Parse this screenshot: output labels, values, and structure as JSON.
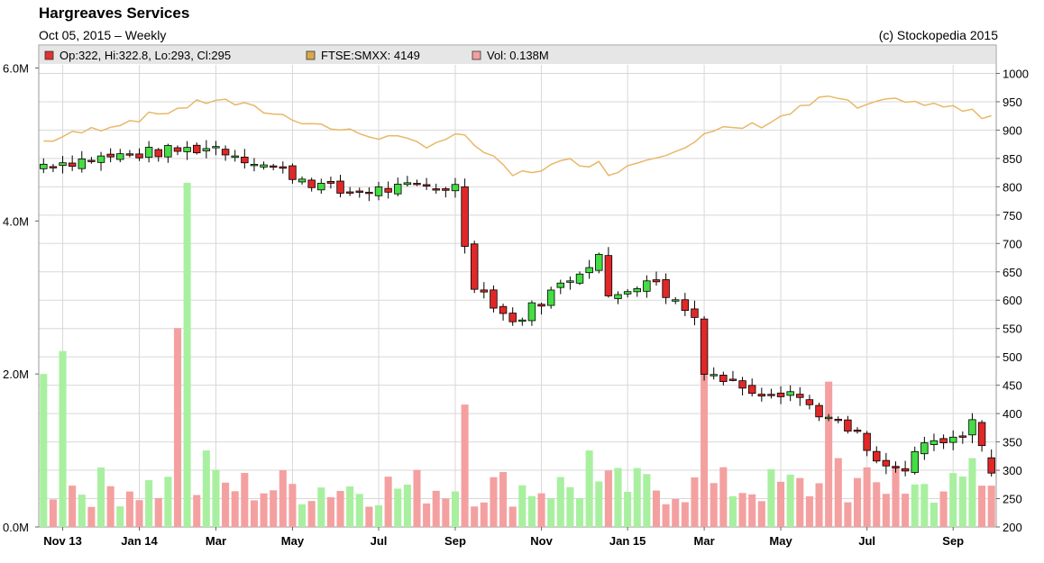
{
  "header": {
    "title": "Hargreaves Services",
    "subtitle": "Oct 05, 2015 – Weekly",
    "copyright": "(c) Stockopedia 2015"
  },
  "legend": [
    {
      "label": "Op:322, Hi:322.8, Lo:293, Cl:295",
      "color": "#e03030"
    },
    {
      "label": "FTSE:SMXX: 4149",
      "color": "#d9a84a"
    },
    {
      "label": "Vol: 0.138M",
      "color": "#f4a0a0"
    }
  ],
  "colors": {
    "up": "#44dd44",
    "down": "#e02828",
    "index": "#e8b868",
    "vol_up": "#a8f0a0",
    "vol_down": "#f4a0a0",
    "grid": "#d8d8d8"
  },
  "chart_data": {
    "type": "candlestick",
    "title": "Hargreaves Services",
    "price_axis": {
      "ticks": [
        200,
        250,
        300,
        350,
        400,
        450,
        500,
        550,
        600,
        650,
        700,
        750,
        800,
        850,
        900,
        950,
        1000
      ],
      "range": [
        200,
        1050
      ],
      "side": "right"
    },
    "volume_axis": {
      "ticks": [
        "0.0M",
        "2.0M",
        "4.0M",
        "6.0M"
      ],
      "tick_values": [
        0,
        2,
        4,
        6
      ],
      "range": [
        0,
        6.3
      ],
      "side": "left"
    },
    "x_ticks": [
      {
        "label": "Nov 13",
        "week": 2
      },
      {
        "label": "Jan 14",
        "week": 10
      },
      {
        "label": "Mar",
        "week": 18
      },
      {
        "label": "May",
        "week": 26
      },
      {
        "label": "Jul",
        "week": 35
      },
      {
        "label": "Sep",
        "week": 43
      },
      {
        "label": "Nov",
        "week": 52
      },
      {
        "label": "Jan 15",
        "week": 61
      },
      {
        "label": "Mar",
        "week": 69
      },
      {
        "label": "May",
        "week": 77
      },
      {
        "label": "Jul",
        "week": 86
      },
      {
        "label": "Sep",
        "week": 95
      }
    ],
    "num_weeks": 100,
    "key_points": [
      {
        "week": 0,
        "close": 840,
        "index": 880
      },
      {
        "week": 11,
        "close": 860,
        "index": 925
      },
      {
        "week": 18,
        "close": 870,
        "index": 955
      },
      {
        "week": 31,
        "close": 790,
        "index": 900
      },
      {
        "week": 40,
        "close": 800,
        "index": 875
      },
      {
        "week": 43,
        "close": 800,
        "index": 890
      },
      {
        "week": 44,
        "close": 700,
        "index": 885
      },
      {
        "week": 45,
        "close": 630,
        "index": 875
      },
      {
        "week": 49,
        "close": 560,
        "index": 820
      },
      {
        "week": 55,
        "close": 640,
        "index": 845
      },
      {
        "week": 58,
        "close": 680,
        "index": 840
      },
      {
        "week": 59,
        "close": 600,
        "index": 825
      },
      {
        "week": 63,
        "close": 640,
        "index": 850
      },
      {
        "week": 68,
        "close": 570,
        "index": 880
      },
      {
        "week": 69,
        "close": 480,
        "index": 890
      },
      {
        "week": 71,
        "close": 460,
        "index": 900
      },
      {
        "week": 75,
        "close": 440,
        "index": 910
      },
      {
        "week": 78,
        "close": 440,
        "index": 930
      },
      {
        "week": 82,
        "close": 390,
        "index": 960
      },
      {
        "week": 85,
        "close": 360,
        "index": 940
      },
      {
        "week": 87,
        "close": 310,
        "index": 945
      },
      {
        "week": 90,
        "close": 300,
        "index": 955
      },
      {
        "week": 92,
        "close": 345,
        "index": 945
      },
      {
        "week": 95,
        "close": 350,
        "index": 940
      },
      {
        "week": 97,
        "close": 390,
        "index": 930
      },
      {
        "week": 98,
        "close": 340,
        "index": 925
      },
      {
        "week": 99,
        "close": 295,
        "index": 930
      }
    ],
    "volume_spikes": [
      {
        "week": 0,
        "value": 2.0
      },
      {
        "week": 2,
        "value": 2.3
      },
      {
        "week": 14,
        "value": 2.6
      },
      {
        "week": 15,
        "value": 4.5
      },
      {
        "week": 17,
        "value": 1.0
      },
      {
        "week": 44,
        "value": 1.6
      },
      {
        "week": 57,
        "value": 1.0
      },
      {
        "week": 69,
        "value": 2.0
      },
      {
        "week": 82,
        "value": 1.9
      },
      {
        "week": 83,
        "value": 0.9
      },
      {
        "week": 89,
        "value": 0.8
      },
      {
        "week": 97,
        "value": 0.9
      }
    ]
  }
}
